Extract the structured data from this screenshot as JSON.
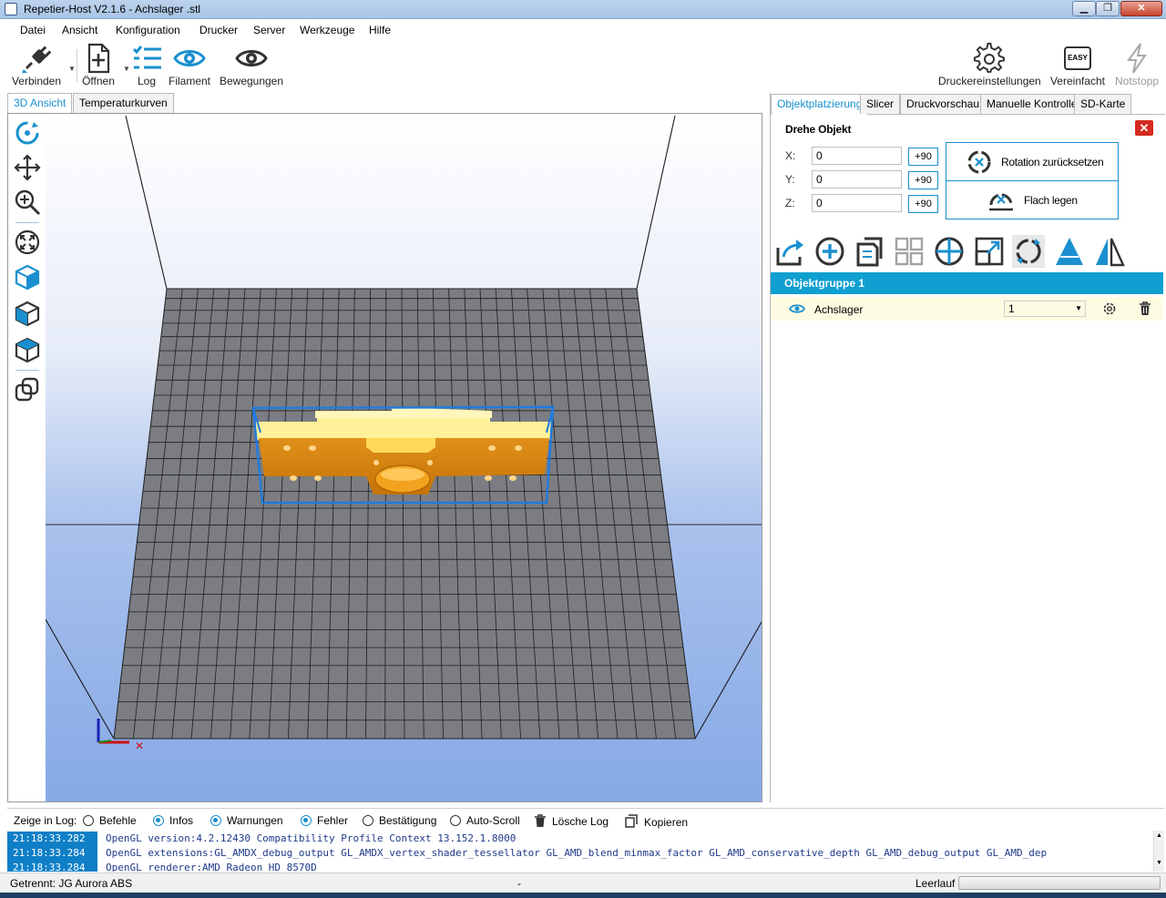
{
  "window": {
    "title": "Repetier-Host V2.1.6 - Achslager .stl"
  },
  "menu": [
    "Datei",
    "Ansicht",
    "Konfiguration",
    "Drucker",
    "Server",
    "Werkzeuge",
    "Hilfe"
  ],
  "toolbar": {
    "connect": "Verbinden",
    "open": "Öffnen",
    "log": "Log",
    "filament": "Filament",
    "moves": "Bewegungen",
    "printer_settings": "Druckereinstellungen",
    "easy_label": "Vereinfacht",
    "easy_badge": "EASY",
    "emergency": "Notstopp"
  },
  "left_tabs": [
    "3D Ansicht",
    "Temperaturkurven"
  ],
  "right_tabs": [
    "Objektplatzierung",
    "Slicer",
    "Druckvorschau",
    "Manuelle Kontrolle",
    "SD-Karte"
  ],
  "rotate": {
    "title": "Drehe Objekt",
    "close": "✕",
    "x_label": "X:",
    "y_label": "Y:",
    "z_label": "Z:",
    "x_value": "0",
    "y_value": "0",
    "z_value": "0",
    "plus90": "+90",
    "reset": "Rotation zurücksetzen",
    "flat": "Flach legen"
  },
  "objects": {
    "group": "Objektgruppe 1",
    "name": "Achslager",
    "copies": "1"
  },
  "log": {
    "show_label": "Zeige in Log:",
    "filters": [
      {
        "label": "Befehle",
        "on": false
      },
      {
        "label": "Infos",
        "on": true
      },
      {
        "label": "Warnungen",
        "on": true
      },
      {
        "label": "Fehler",
        "on": true
      },
      {
        "label": "Bestätigung",
        "on": false
      },
      {
        "label": "Auto-Scroll",
        "on": false
      }
    ],
    "clear": "Lösche Log",
    "copy": "Kopieren",
    "lines": [
      {
        "time": "21:18:33.282",
        "text": "OpenGL version:4.2.12430 Compatibility Profile Context 13.152.1.8000"
      },
      {
        "time": "21:18:33.284",
        "text": "OpenGL extensions:GL_AMDX_debug_output GL_AMDX_vertex_shader_tessellator GL_AMD_blend_minmax_factor GL_AMD_conservative_depth GL_AMD_debug_output GL_AMD_dep"
      },
      {
        "time": "21:18:33.284",
        "text": "OpenGL renderer:AMD Radeon HD 8570D"
      }
    ]
  },
  "status": {
    "connection": "Getrennt: JG Aurora ABS",
    "middle": "-",
    "state": "Leerlauf"
  },
  "colors": {
    "accent": "#1a8fcf",
    "group_bar": "#0f9fd0",
    "model": "#d98a0a",
    "model_top": "#fff199",
    "bbox": "#1e7be0",
    "sky_top": "#ffffff",
    "sky_bottom": "#86a9e6",
    "bed": "#7b7d82"
  }
}
